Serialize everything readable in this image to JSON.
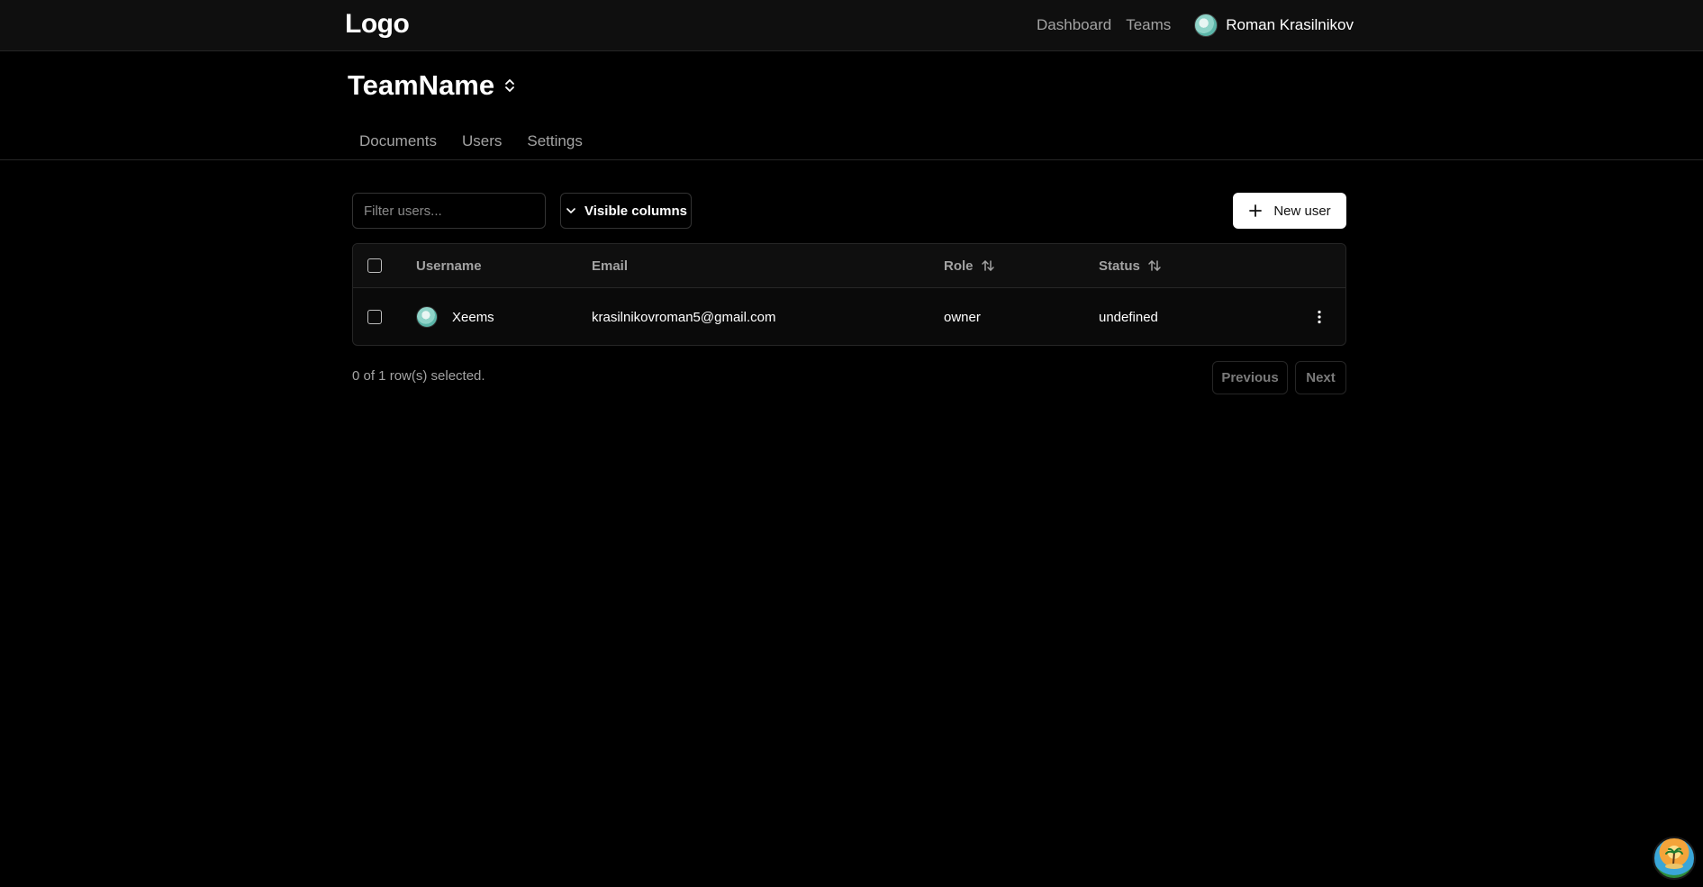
{
  "topbar": {
    "logo": "Logo",
    "nav": [
      {
        "label": "Dashboard"
      },
      {
        "label": "Teams"
      }
    ],
    "user_name": "Roman Krasilnikov"
  },
  "team": {
    "name": "TeamName",
    "tabs": [
      {
        "label": "Documents"
      },
      {
        "label": "Users"
      },
      {
        "label": "Settings"
      }
    ]
  },
  "toolbar": {
    "filter_placeholder": "Filter users...",
    "visible_columns_label": "Visible columns",
    "new_user_label": "New user"
  },
  "table": {
    "columns": {
      "username": "Username",
      "email": "Email",
      "role": "Role",
      "status": "Status"
    },
    "rows": [
      {
        "username": "Xeems",
        "email": "krasilnikovroman5@gmail.com",
        "role": "owner",
        "status": "undefined"
      }
    ]
  },
  "footer": {
    "selected_text": "0 of 1 row(s) selected.",
    "previous_label": "Previous",
    "next_label": "Next"
  },
  "icons": {
    "team_switcher": "chevrons-up-down-icon",
    "visible_columns": "chevron-down-icon",
    "new_user": "plus-icon",
    "sort": "arrow-up-down-icon",
    "row_actions": "more-vertical-icon"
  }
}
